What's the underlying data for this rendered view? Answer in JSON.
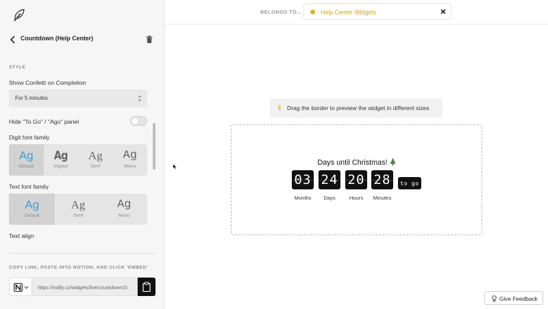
{
  "sidebar": {
    "widget_title": "Countdown (Help Center)",
    "style_section_label": "STYLE",
    "confetti": {
      "label": "Show Confetti on Completion",
      "value": "For 5 minutes"
    },
    "hide_panel": {
      "label": "Hide \"To Go\" / \"Ago\" panel",
      "enabled": false
    },
    "digit_font": {
      "label": "Digit font family",
      "options": [
        {
          "sample": "Ag",
          "name": "Default",
          "selected": true
        },
        {
          "sample": "Ag",
          "name": "Impact",
          "selected": false
        },
        {
          "sample": "Ag",
          "name": "Serif",
          "selected": false
        },
        {
          "sample": "Ag",
          "name": "Mono",
          "selected": false
        }
      ]
    },
    "text_font": {
      "label": "Text font family",
      "options": [
        {
          "sample": "Ag",
          "name": "Default",
          "selected": true
        },
        {
          "sample": "Ag",
          "name": "Serif",
          "selected": false
        },
        {
          "sample": "Ag",
          "name": "Mono",
          "selected": false
        }
      ]
    },
    "text_align_label": "Text align",
    "embed": {
      "label": "COPY LINK, PASTE INTO NOTION, AND CLICK 'EMBED'",
      "url": "https://indify.co/widgets/live/countdown/2i",
      "platform_icon": "notion-icon"
    }
  },
  "topbar": {
    "belongs_label": "BELONGS TO...",
    "collection_name": "Help Center Widgets",
    "collection_color": "#e0b21a"
  },
  "canvas": {
    "hint": "Drag the border to preview the widget in different sizes",
    "countdown": {
      "title": "Days until Christmas!",
      "units": [
        {
          "value": "03",
          "label": "Months"
        },
        {
          "value": "24",
          "label": "Days"
        },
        {
          "value": "20",
          "label": "Hours"
        },
        {
          "value": "28",
          "label": "Minutes"
        }
      ],
      "suffix": "to go"
    }
  },
  "feedback_label": "Give Feedback",
  "colors": {
    "accent": "#3aa0dd",
    "digit_bg": "#111111"
  }
}
